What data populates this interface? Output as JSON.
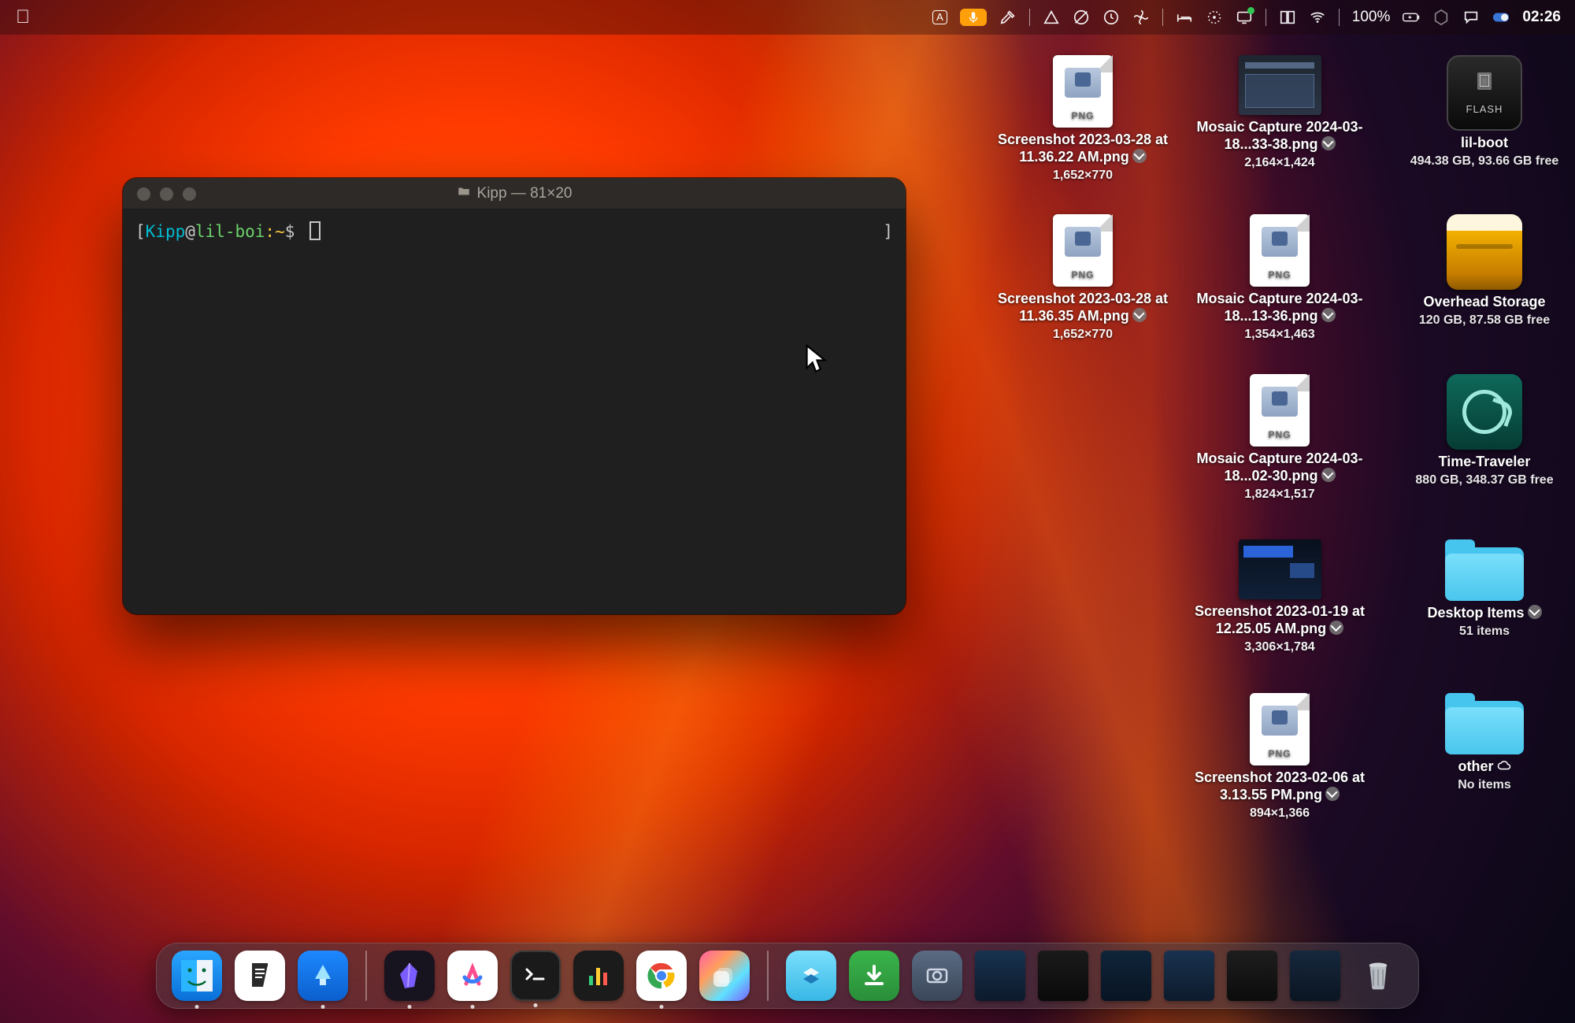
{
  "menubar": {
    "battery_text": "100%",
    "clock": "02:26",
    "keyboard_indicator": "A"
  },
  "terminal": {
    "title_folder": "Kipp",
    "title_dims": "81×20",
    "prompt_open": "[",
    "prompt_user": "Kipp",
    "prompt_at": "@",
    "prompt_host": "lil-boi",
    "prompt_sep": ":",
    "prompt_path": "~",
    "prompt_dollar": "$",
    "right_bracket": "]"
  },
  "desktop": {
    "col1": [
      {
        "name": "Screenshot 2023-03-28 at 11.36.22 AM.png",
        "dims": "1,652×770",
        "badge": "download",
        "icon": "png"
      },
      {
        "name": "Screenshot 2023-03-28 at 11.36.35 AM.png",
        "dims": "1,652×770",
        "badge": "download",
        "icon": "png"
      }
    ],
    "col2": [
      {
        "name": "Mosaic Capture 2024-03-18...33-38.png",
        "dims": "2,164×1,424",
        "badge": "download",
        "icon": "thumb-dark"
      },
      {
        "name": "Mosaic Capture 2024-03-18...13-36.png",
        "dims": "1,354×1,463",
        "badge": "download",
        "icon": "png"
      },
      {
        "name": "Mosaic Capture 2024-03-18...02-30.png",
        "dims": "1,824×1,517",
        "badge": "download",
        "icon": "png"
      },
      {
        "name": "Screenshot 2023-01-19 at 12.25.05 AM.png",
        "dims": "3,306×1,784",
        "badge": "download",
        "icon": "thumb-blue"
      },
      {
        "name": "Screenshot 2023-02-06 at 3.13.55 PM.png",
        "dims": "894×1,366",
        "badge": "download",
        "icon": "png"
      }
    ],
    "col3": [
      {
        "name": "lil-boot",
        "sub": "494.38 GB, 93.66 GB free",
        "icon": "drive-dark"
      },
      {
        "name": "Overhead Storage",
        "sub": "120 GB, 87.58 GB free",
        "icon": "drive-gold"
      },
      {
        "name": "Time-Traveler",
        "sub": "880 GB, 348.37 GB free",
        "icon": "drive-tm"
      },
      {
        "name": "Desktop Items",
        "sub": "51 items",
        "badge": "download",
        "icon": "folder"
      },
      {
        "name": "other",
        "sub": "No items",
        "badge": "cloud",
        "icon": "folder"
      }
    ]
  },
  "dock": {
    "apps": [
      "Finder",
      "Notes",
      "Beacon",
      "Obsidian",
      "Arc",
      "Terminal",
      "Activity",
      "Chrome",
      "Shortcuts"
    ],
    "right": [
      "Applications",
      "Downloads",
      "Screenshots",
      "Window1",
      "Window2",
      "Window3",
      "Window4",
      "Window5",
      "Window6",
      "Trash"
    ]
  }
}
